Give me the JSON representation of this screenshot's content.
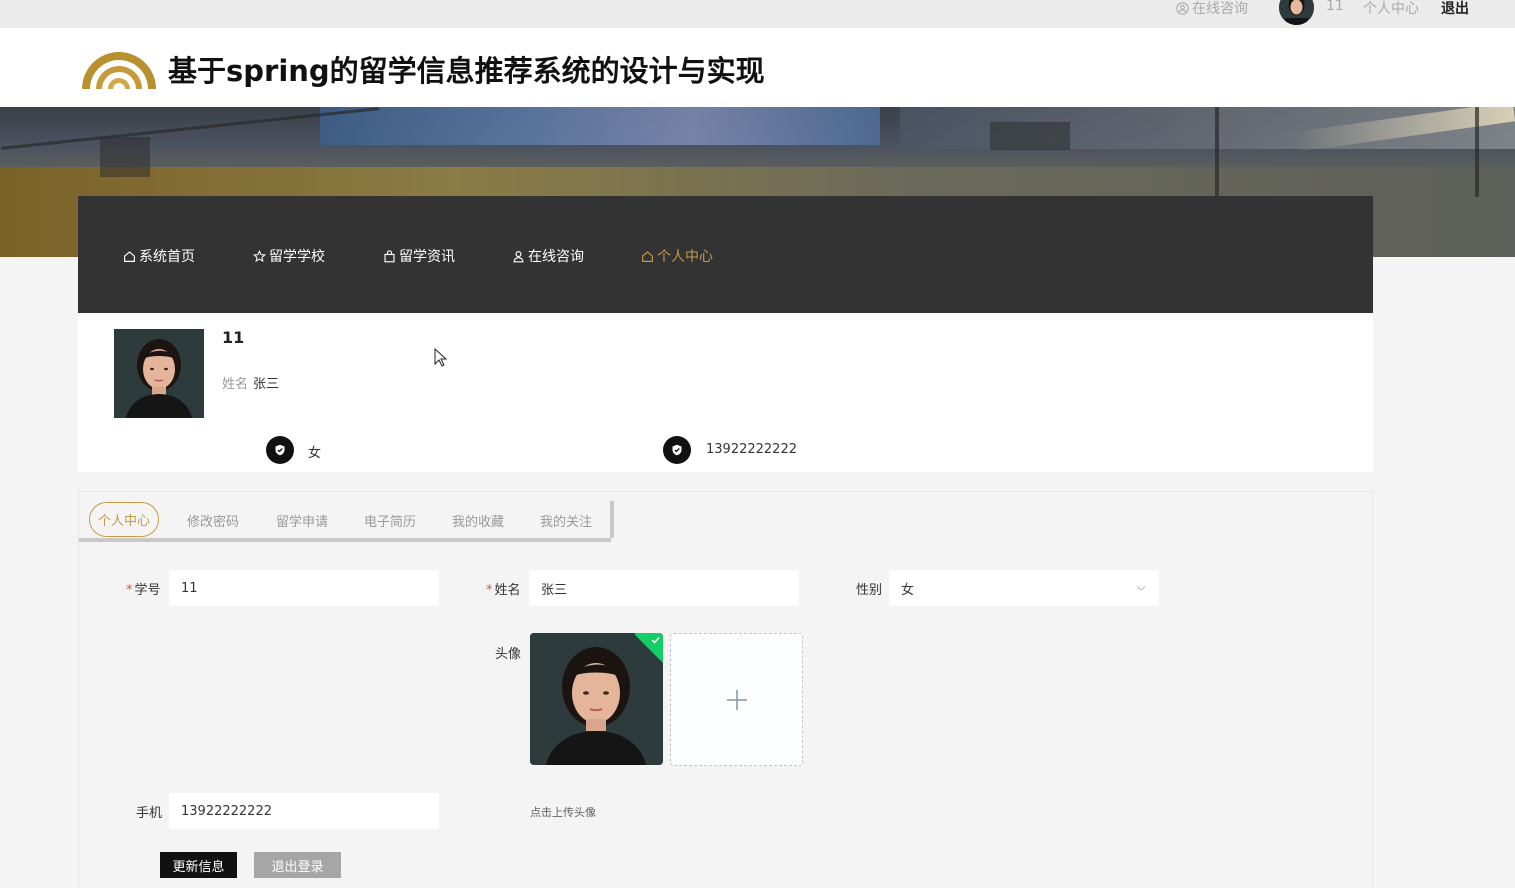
{
  "topbar": {
    "consult_label": "在线咨询",
    "username": "11",
    "center_label": "个人中心",
    "logout_label": "退出"
  },
  "header": {
    "title": "基于spring的留学信息推荐系统的设计与实现"
  },
  "nav": {
    "items": [
      {
        "label": "系统首页",
        "icon": "home-icon"
      },
      {
        "label": "留学学校",
        "icon": "star-icon"
      },
      {
        "label": "留学资讯",
        "icon": "bag-icon"
      },
      {
        "label": "在线咨询",
        "icon": "user-icon"
      },
      {
        "label": "个人中心",
        "icon": "home-icon",
        "active": true
      }
    ]
  },
  "profile": {
    "username": "11",
    "name_label": "姓名",
    "name_value": "张三",
    "gender": "女",
    "phone": "13922222222"
  },
  "tabs": {
    "items": [
      "个人中心",
      "修改密码",
      "留学申请",
      "电子简历",
      "我的收藏",
      "我的关注"
    ],
    "active": "个人中心"
  },
  "form": {
    "student_no_label": "学号",
    "student_no_value": "11",
    "name_label": "姓名",
    "name_value": "张三",
    "gender_label": "性别",
    "gender_value": "女",
    "avatar_label": "头像",
    "upload_tip": "点击上传头像",
    "phone_label": "手机",
    "phone_value": "13922222222",
    "required_mark": "*"
  },
  "buttons": {
    "update_label": "更新信息",
    "logout_label": "退出登录"
  },
  "colors": {
    "accent": "#c49a4a",
    "nav_bg": "#333333",
    "success": "#13ce66"
  }
}
